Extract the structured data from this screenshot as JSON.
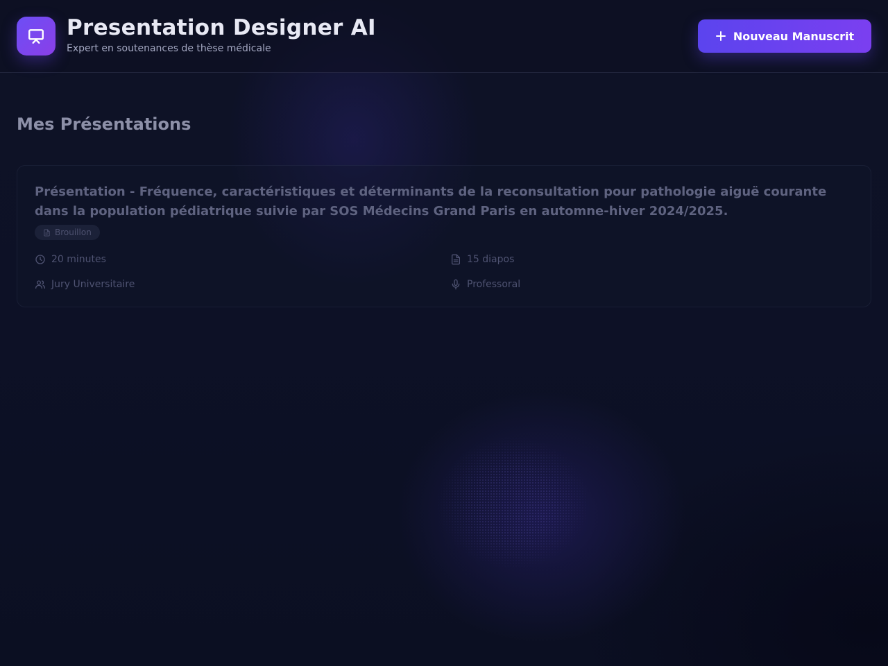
{
  "header": {
    "title": "Presentation Designer AI",
    "subtitle": "Expert en soutenances de thèse médicale",
    "logo_icon": "presentation-board-icon",
    "new_button_label": "Nouveau Manuscrit",
    "new_button_icon": "plus-icon"
  },
  "main": {
    "section_title": "Mes Présentations",
    "presentations": [
      {
        "title": "Présentation - Fréquence, caractéristiques et déterminants de la reconsultation pour pathologie aiguë courante dans la population pédiatrique suivie par SOS Médecins Grand Paris en automne-hiver 2024/2025.",
        "status": "Brouillon",
        "status_icon": "file-icon",
        "duration": "20 minutes",
        "duration_icon": "clock-icon",
        "slides": "15 diapos",
        "slides_icon": "document-icon",
        "audience": "Jury Universitaire",
        "audience_icon": "users-icon",
        "tone": "Professoral",
        "tone_icon": "microphone-icon"
      }
    ]
  },
  "colors": {
    "accent": "#6d4ef5",
    "accent_end": "#8a3fe8",
    "background": "#0d1126"
  }
}
